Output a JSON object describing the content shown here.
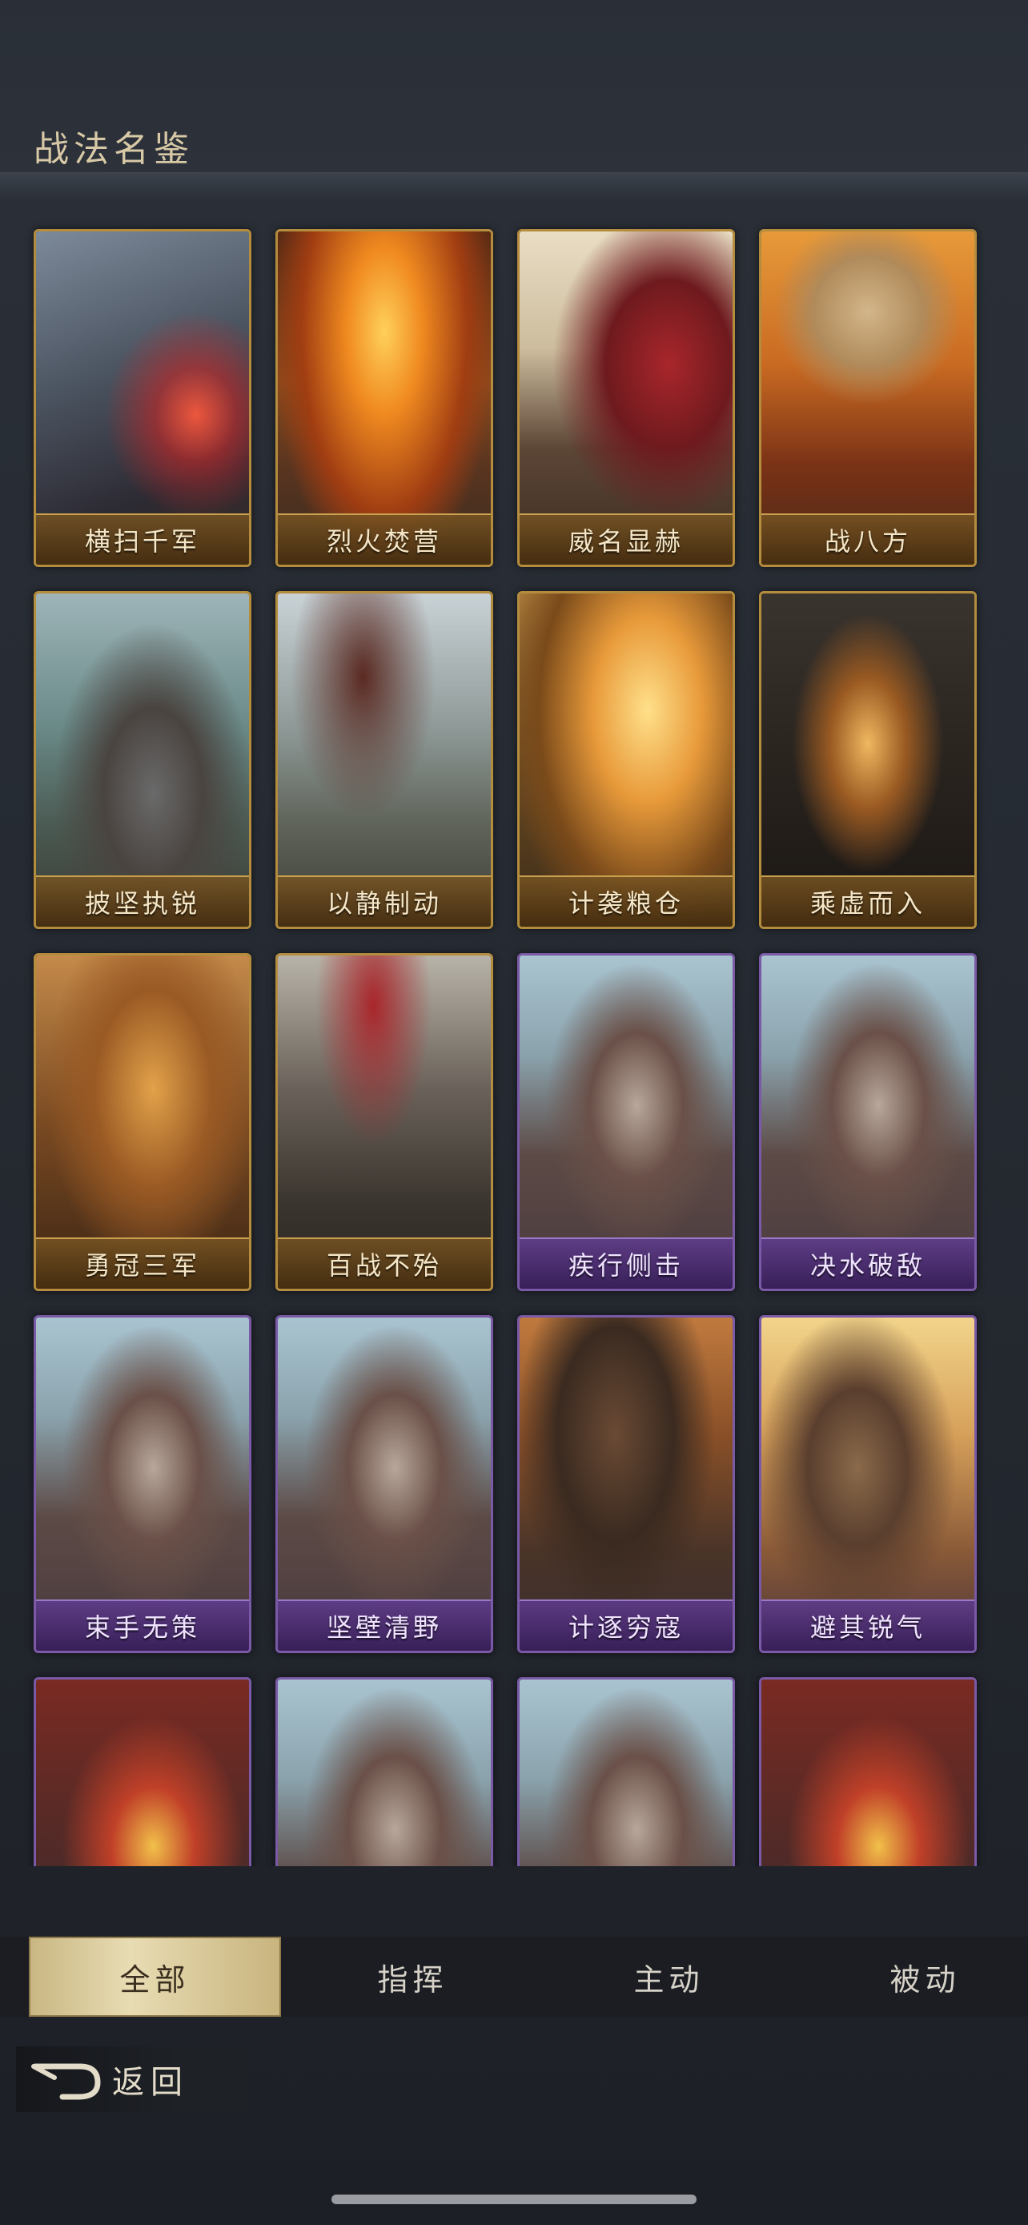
{
  "header": {
    "title": "战法名鉴"
  },
  "cards": [
    {
      "label": "横扫千军",
      "rarity": "gold",
      "art": "cavalry-slash"
    },
    {
      "label": "烈火焚营",
      "rarity": "gold",
      "art": "burning-fort"
    },
    {
      "label": "威名显赫",
      "rarity": "gold",
      "art": "mounted-general"
    },
    {
      "label": "战八方",
      "rarity": "gold",
      "art": "war-drum"
    },
    {
      "label": "披坚执锐",
      "rarity": "gold",
      "art": "armored-warrior"
    },
    {
      "label": "以静制动",
      "rarity": "gold",
      "art": "banner-soldier"
    },
    {
      "label": "计袭粮仓",
      "rarity": "gold",
      "art": "torch-raid"
    },
    {
      "label": "乘虚而入",
      "rarity": "gold",
      "art": "night-gate"
    },
    {
      "label": "勇冠三军",
      "rarity": "gold",
      "art": "charging-general"
    },
    {
      "label": "百战不殆",
      "rarity": "gold",
      "art": "red-banner-army"
    },
    {
      "label": "疾行侧击",
      "rarity": "purple",
      "art": "white-plume-rider"
    },
    {
      "label": "决水破敌",
      "rarity": "purple",
      "art": "white-plume-rider"
    },
    {
      "label": "束手无策",
      "rarity": "purple",
      "art": "white-plume-rider"
    },
    {
      "label": "坚壁清野",
      "rarity": "purple",
      "art": "white-plume-rider"
    },
    {
      "label": "计逐穷寇",
      "rarity": "purple",
      "art": "dark-general"
    },
    {
      "label": "避其锐气",
      "rarity": "purple",
      "art": "spear-general"
    },
    {
      "label": "",
      "rarity": "purple",
      "art": "red-cape-rider"
    },
    {
      "label": "",
      "rarity": "purple",
      "art": "white-plume-rider"
    },
    {
      "label": "",
      "rarity": "purple",
      "art": "white-plume-rider"
    },
    {
      "label": "",
      "rarity": "purple",
      "art": "red-cape-rider"
    }
  ],
  "tabs": [
    {
      "label": "全部",
      "active": true
    },
    {
      "label": "指挥",
      "active": false
    },
    {
      "label": "主动",
      "active": false
    },
    {
      "label": "被动",
      "active": false
    }
  ],
  "back": {
    "label": "返回",
    "icon": "back-arrow-icon"
  },
  "colors": {
    "gold": "#b48c3e",
    "purple": "#7a5aa6",
    "tab_active": "#e8dcb3"
  }
}
